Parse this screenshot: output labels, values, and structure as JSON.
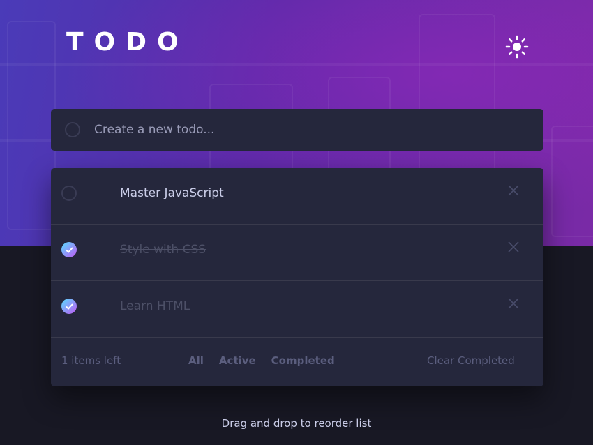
{
  "app": {
    "title": "TODO",
    "theme_icon": "sun-icon"
  },
  "new_todo": {
    "placeholder": "Create a new todo..."
  },
  "todos": [
    {
      "text": "Master JavaScript",
      "completed": false
    },
    {
      "text": "Style with CSS",
      "completed": true
    },
    {
      "text": "Learn HTML",
      "completed": true
    }
  ],
  "footer": {
    "items_left": "1 items left",
    "filters": {
      "all": "All",
      "active": "Active",
      "completed": "Completed"
    },
    "clear": "Clear Completed"
  },
  "hint": "Drag and drop to reorder list",
  "colors": {
    "background": "#181824",
    "card": "#25273c",
    "text": "#cacde8",
    "muted": "#5b5e7e",
    "check_gradient_start": "#57ddff",
    "check_gradient_end": "#c058f3"
  }
}
